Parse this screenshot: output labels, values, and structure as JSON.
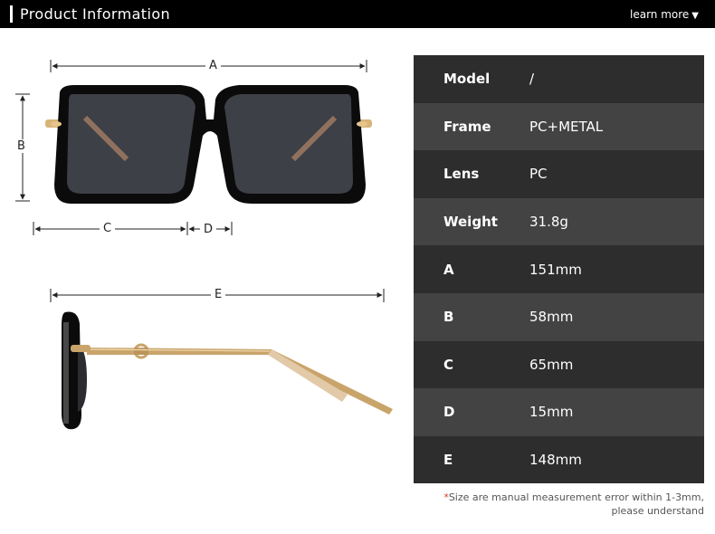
{
  "header": {
    "title": "Product Information",
    "learn_more": "learn more",
    "arrow": "▼"
  },
  "dimensions": {
    "a": "A",
    "b": "B",
    "c": "C",
    "d": "D",
    "e": "E"
  },
  "specs": [
    {
      "key": "Model",
      "value": "/"
    },
    {
      "key": "Frame",
      "value": "PC+METAL"
    },
    {
      "key": "Lens",
      "value": "PC"
    },
    {
      "key": "Weight",
      "value": "31.8g"
    },
    {
      "key": "A",
      "value": "151mm"
    },
    {
      "key": "B",
      "value": "58mm"
    },
    {
      "key": "C",
      "value": "65mm"
    },
    {
      "key": "D",
      "value": "15mm"
    },
    {
      "key": "E",
      "value": "148mm"
    }
  ],
  "footnote": {
    "star": "*",
    "line1": "Size are manual measurement error within 1-3mm,",
    "line2": "please understand"
  },
  "colors": {
    "header_bg": "#000000",
    "row_dark": "#2d2d2d",
    "row_light": "#434343",
    "frame": "#0b0b0b",
    "lens": "#3d4046",
    "temple_gold": "#c9a46a"
  }
}
